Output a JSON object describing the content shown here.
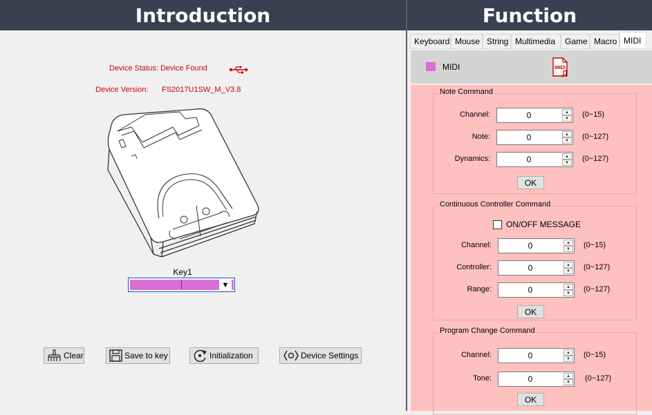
{
  "headers": {
    "left": "Introduction",
    "right": "Function"
  },
  "introduction": {
    "status_text": "Device Status: Device Found",
    "version_label": "Device Version:",
    "version_value": "FS2017U1SW_M_V3.8",
    "key_label": "Key1",
    "key_color": "#da70d6",
    "buttons": {
      "clear": "Clear",
      "save": "Save to key",
      "init": "Initialization",
      "settings": "Device Settings"
    }
  },
  "tabs": [
    "Keyboard",
    "Mouse",
    "String",
    "Multimedia",
    "Game",
    "Macro",
    "MIDI"
  ],
  "active_tab": "MIDI",
  "midi_bar": {
    "label": "MIDI",
    "swatch_color": "#da70d6",
    "icon_text": "MIDI"
  },
  "note_command": {
    "title": "Note Command",
    "rows": [
      {
        "label": "Channel:",
        "value": "0",
        "range": "(0~15)"
      },
      {
        "label": "Note:",
        "value": "0",
        "range": "(0~127)"
      },
      {
        "label": "Dynamics:",
        "value": "0",
        "range": "(0~127)"
      }
    ],
    "ok": "OK"
  },
  "cc_command": {
    "title": "Continuous Controller Command",
    "checkbox_label": "ON/OFF MESSAGE",
    "rows": [
      {
        "label": "Channel:",
        "value": "0",
        "range": "(0~15)"
      },
      {
        "label": "Controller:",
        "value": "0",
        "range": "(0~127)"
      },
      {
        "label": "Range:",
        "value": "0",
        "range": "(0~127)"
      }
    ],
    "ok": "OK"
  },
  "pc_command": {
    "title": "Program Change Command",
    "rows": [
      {
        "label": "Channel:",
        "value": "0",
        "range": "(0~15)"
      },
      {
        "label": "Tone:",
        "value": "0",
        "range": "(0~127)"
      }
    ],
    "ok": "OK"
  }
}
